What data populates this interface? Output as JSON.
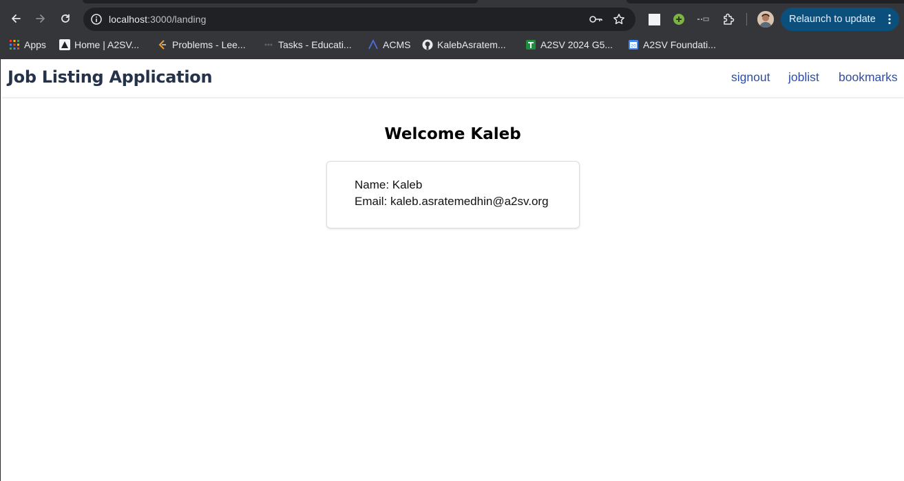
{
  "browser": {
    "url_host": "localhost",
    "url_path": ":3000/landing",
    "relaunch_label": "Relaunch to update",
    "bookmarks": [
      {
        "label": "Apps",
        "icon": "apps-grid-icon"
      },
      {
        "label": "Home | A2SV...",
        "icon": "a2sv-icon"
      },
      {
        "label": "Problems - Lee...",
        "icon": "leetcode-icon"
      },
      {
        "label": "Tasks - Educati...",
        "icon": "tasks-icon"
      },
      {
        "label": "ACMS",
        "icon": "acms-icon"
      },
      {
        "label": "KalebAsratem...",
        "icon": "github-icon"
      },
      {
        "label": "A2SV 2024 G5...",
        "icon": "sheets-icon"
      },
      {
        "label": "A2SV Foundati...",
        "icon": "calendar-icon"
      }
    ],
    "colors": {
      "chrome_bg": "#35363a",
      "omnibox_bg": "#202124",
      "relaunch_bg": "#0b4f7d"
    }
  },
  "app": {
    "title": "Job Listing Application",
    "nav": [
      "signout",
      "joblist",
      "bookmarks"
    ],
    "welcome": "Welcome Kaleb",
    "profile": {
      "name_line": "Name: Kaleb",
      "email_line": "Email: kaleb.asratemedhin@a2sv.org"
    },
    "colors": {
      "title": "#25324b",
      "link": "#2d4da8"
    }
  }
}
